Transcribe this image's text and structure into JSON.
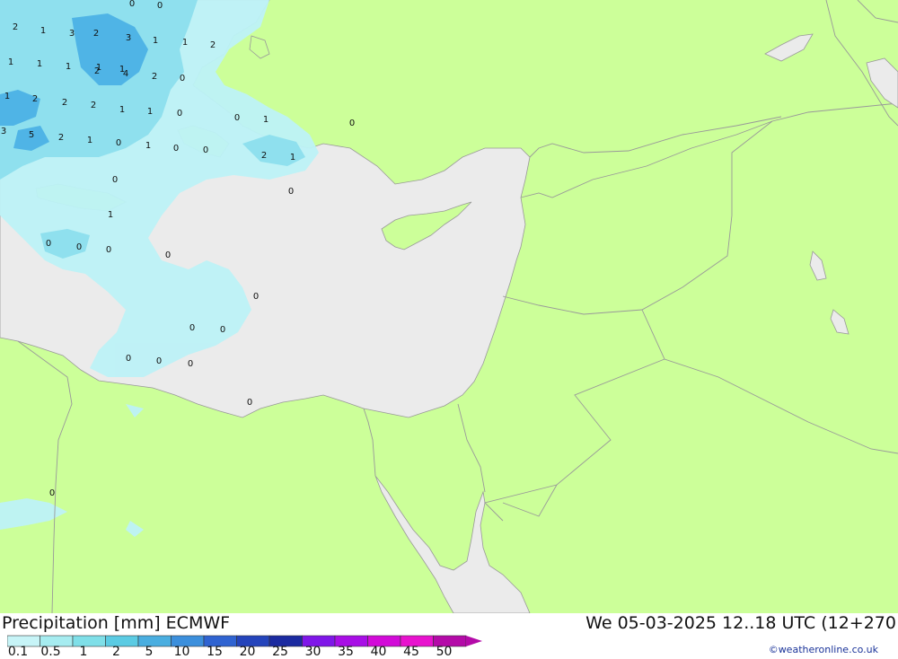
{
  "title": {
    "label": "Precipitation [mm] ECMWF",
    "datetime": "We 05-03-2025 12..18 UTC (12+270"
  },
  "legend": {
    "ticks": [
      "0.1",
      "0.5",
      "1",
      "2",
      "5",
      "10",
      "15",
      "20",
      "25",
      "30",
      "35",
      "40",
      "45",
      "50"
    ],
    "colors": [
      "#c7f4f7",
      "#a6ecf0",
      "#7fdfe8",
      "#5bcbe3",
      "#4aaee0",
      "#3c8fdc",
      "#2f63d1",
      "#2444bb",
      "#1b2aa0",
      "#7f16e8",
      "#a80ee6",
      "#d20ad8",
      "#e812ce",
      "#b40aa8"
    ]
  },
  "credit": "©weatheronline.co.uk",
  "map_colors": {
    "land": "#ccff99",
    "sea": "#ebebeb",
    "border": "#999999",
    "precip_light": "#bdf2f7",
    "precip_mid": "#8fe0ee",
    "precip_heavy": "#4fb4e6"
  },
  "map_values": [
    {
      "v": "2"
    },
    {
      "v": "1"
    },
    {
      "v": "0"
    },
    {
      "v": "0"
    },
    {
      "v": "2"
    },
    {
      "v": "1"
    },
    {
      "v": "3"
    },
    {
      "v": "3"
    },
    {
      "v": "2"
    },
    {
      "v": "1"
    },
    {
      "v": "1"
    },
    {
      "v": "1"
    },
    {
      "v": "1"
    },
    {
      "v": "1"
    },
    {
      "v": "1"
    },
    {
      "v": "2"
    },
    {
      "v": "4"
    },
    {
      "v": "2"
    },
    {
      "v": "0"
    },
    {
      "v": "1"
    },
    {
      "v": "2"
    },
    {
      "v": "2"
    },
    {
      "v": "2"
    },
    {
      "v": "1"
    },
    {
      "v": "1"
    },
    {
      "v": "0"
    },
    {
      "v": "0"
    },
    {
      "v": "1"
    },
    {
      "v": "0"
    },
    {
      "v": "3"
    },
    {
      "v": "5"
    },
    {
      "v": "2"
    },
    {
      "v": "1"
    },
    {
      "v": "0"
    },
    {
      "v": "1"
    },
    {
      "v": "0"
    },
    {
      "v": "0"
    },
    {
      "v": "2"
    },
    {
      "v": "1"
    },
    {
      "v": "0"
    },
    {
      "v": "0"
    },
    {
      "v": "1"
    },
    {
      "v": "0"
    },
    {
      "v": "0"
    },
    {
      "v": "0"
    },
    {
      "v": "0"
    },
    {
      "v": "0"
    },
    {
      "v": "0"
    },
    {
      "v": "0"
    },
    {
      "v": "0"
    },
    {
      "v": "0"
    },
    {
      "v": "0"
    },
    {
      "v": "0"
    },
    {
      "v": "0"
    }
  ]
}
